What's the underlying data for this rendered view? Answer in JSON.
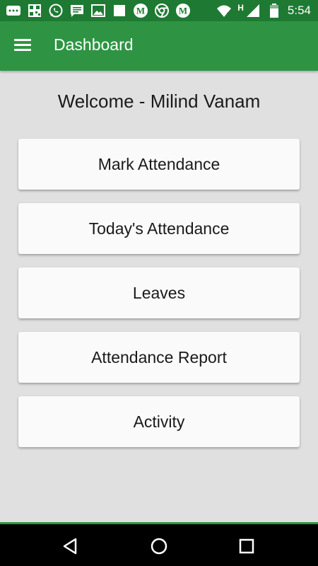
{
  "status_bar": {
    "time": "5:54",
    "network_type": "H",
    "left_icons": [
      "message-icon",
      "qr-icon",
      "whatsapp-icon",
      "chat-icon",
      "image-icon",
      "square-icon",
      "gmail-icon",
      "chrome-icon",
      "gmail-icon"
    ],
    "right_icons": [
      "wifi-icon",
      "signal-icon",
      "battery-icon"
    ]
  },
  "app_bar": {
    "title": "Dashboard",
    "color": "#2e9443"
  },
  "main": {
    "welcome_text": "Welcome - Milind Vanam",
    "menu_items": [
      {
        "label": "Mark Attendance"
      },
      {
        "label": "Today's Attendance"
      },
      {
        "label": "Leaves"
      },
      {
        "label": "Attendance Report"
      },
      {
        "label": "Activity"
      }
    ]
  },
  "nav_bar": {
    "buttons": [
      "back-icon",
      "home-icon",
      "recents-icon"
    ]
  }
}
